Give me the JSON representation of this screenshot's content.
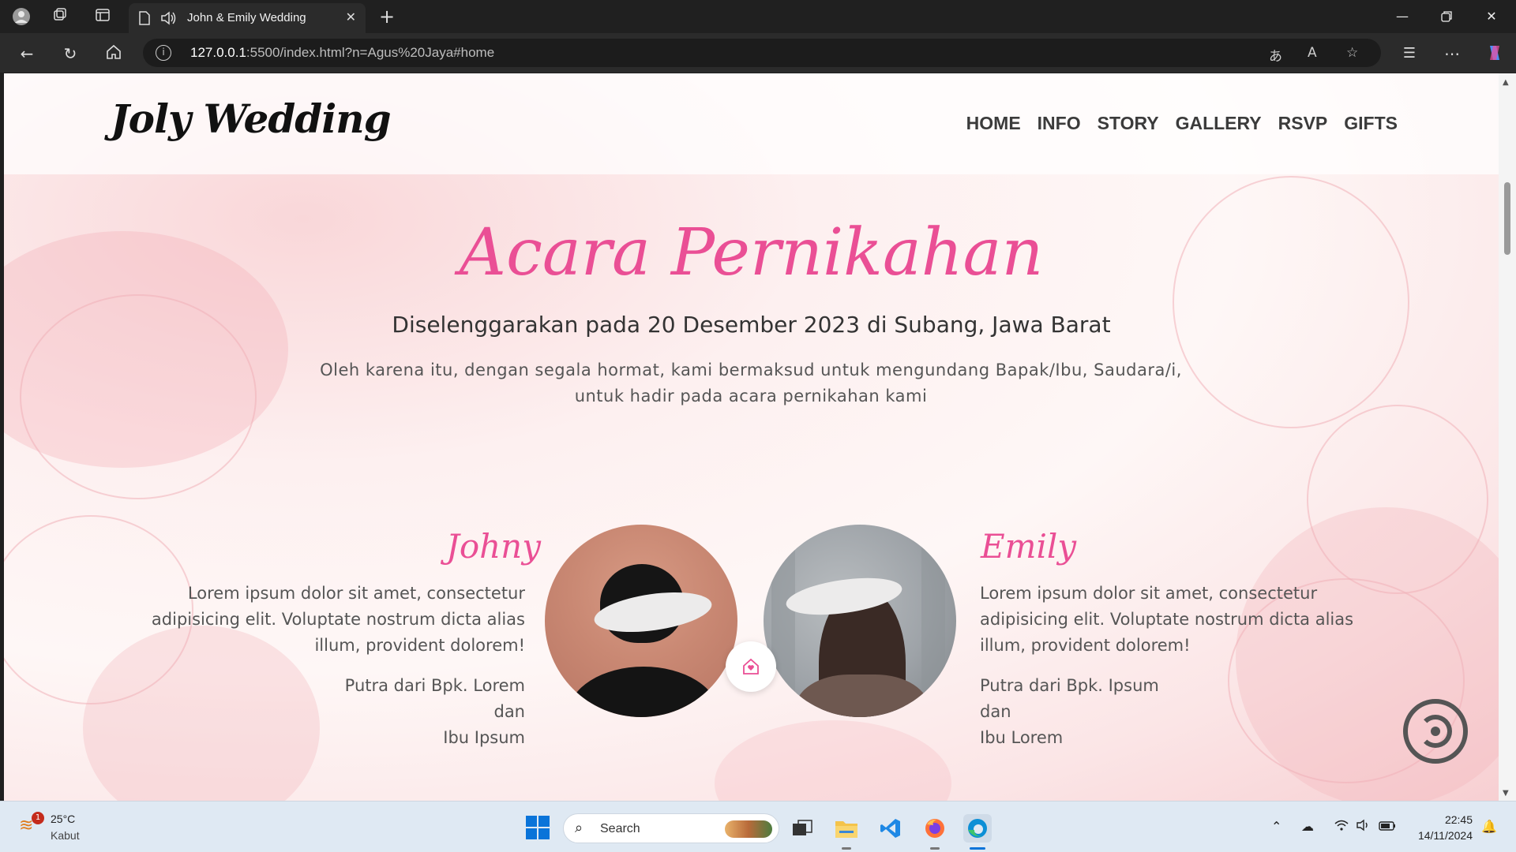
{
  "browser": {
    "tab_title": "John & Emily Wedding",
    "url_host": "127.0.0.1",
    "url_rest": ":5500/index.html?n=Agus%20Jaya#home"
  },
  "site": {
    "brand": "Joly Wedding",
    "menu": [
      "HOME",
      "INFO",
      "STORY",
      "GALLERY",
      "RSVP",
      "GIFTS"
    ]
  },
  "hero": {
    "title": "Acara Pernikahan",
    "subtitle": "Diselenggarakan pada 20 Desember 2023 di Subang, Jawa Barat",
    "text_line1": "Oleh karena itu, dengan segala hormat, kami bermaksud untuk mengundang Bapak/Ibu, Saudara/i,",
    "text_line2": "untuk hadir pada acara pernikahan kami"
  },
  "groom": {
    "name": "Johny",
    "bio_line1": "Lorem ipsum dolor sit amet, consectetur",
    "bio_line2": "adipisicing elit. Voluptate nostrum dicta alias",
    "bio_line3": "illum, provident dolorem!",
    "parent1": "Putra dari Bpk. Lorem",
    "and": "dan",
    "parent2": "Ibu Ipsum"
  },
  "bride": {
    "name": "Emily",
    "bio_line1": "Lorem ipsum dolor sit amet, consectetur",
    "bio_line2": "adipisicing elit. Voluptate nostrum dicta alias",
    "bio_line3": "illum, provident dolorem!",
    "parent1": "Putra dari Bpk. Ipsum",
    "and": "dan",
    "parent2": "Ibu Lorem"
  },
  "taskbar": {
    "weather_temp": "25°C",
    "weather_desc": "Kabut",
    "weather_badge": "1",
    "search_label": "Search",
    "time": "22:45",
    "date": "14/11/2024"
  },
  "colors": {
    "accent": "#ea4f95",
    "taskbar": "#dfe9f3",
    "chrome": "#202020"
  }
}
